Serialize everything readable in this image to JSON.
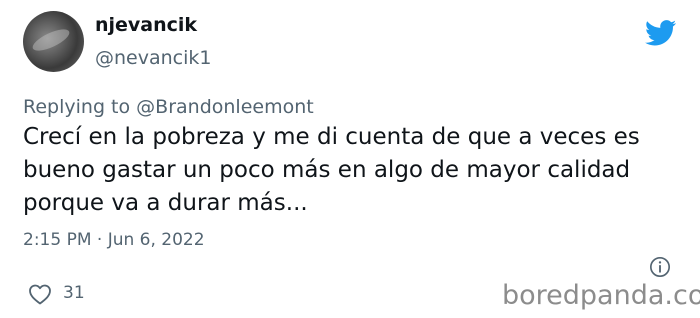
{
  "author": {
    "display_name": "njevancik",
    "handle": "@nevancik1"
  },
  "reply": {
    "prefix": "Replying to ",
    "target": "@Brandonleemont"
  },
  "tweet": {
    "lines": [
      "Crecí en la pobreza y me di cuenta de que a veces es",
      "bueno gastar un poco más en algo de mayor calidad",
      "porque va a durar más..."
    ],
    "timestamp": "2:15 PM · Jun 6, 2022"
  },
  "engagement": {
    "likes": "31"
  },
  "watermark": "boredpanda.com",
  "icons": {
    "brand": "twitter-bird-icon",
    "info": "info-icon",
    "like": "heart-icon"
  },
  "colors": {
    "twitter_blue": "#1d9bf0",
    "secondary_text": "#536471",
    "primary_text": "#0f1419"
  }
}
